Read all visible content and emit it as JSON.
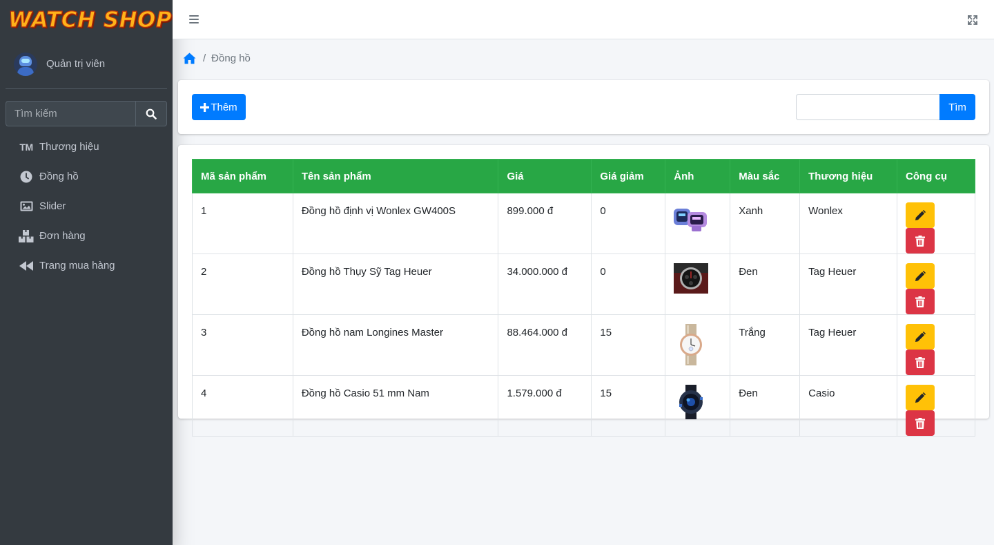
{
  "brand": {
    "logo_text": "WATCH SHOP"
  },
  "user": {
    "name": "Quản trị viên"
  },
  "sidebar": {
    "search_placeholder": "Tìm kiếm",
    "items": [
      {
        "label": "Thương hiệu",
        "icon": "trademark-icon",
        "icon_text": "TM"
      },
      {
        "label": "Đồng hồ",
        "icon": "clock-icon"
      },
      {
        "label": "Slider",
        "icon": "image-icon"
      },
      {
        "label": "Đơn hàng",
        "icon": "boxes-icon"
      },
      {
        "label": "Trang mua hàng",
        "icon": "backward-icon"
      }
    ]
  },
  "breadcrumb": {
    "current": "Đồng hồ"
  },
  "toolbar": {
    "add_label": "Thêm",
    "search_value": "",
    "search_button": "Tìm"
  },
  "table": {
    "headers": [
      "Mã sản phẩm",
      "Tên sản phẩm",
      "Giá",
      "Giá giảm",
      "Ảnh",
      "Màu sắc",
      "Thương hiệu",
      "Công cụ"
    ],
    "rows": [
      {
        "id": "1",
        "name": "Đồng hồ định vị Wonlex GW400S",
        "price": "899.000 đ",
        "discount": "0",
        "color": "Xanh",
        "brand": "Wonlex"
      },
      {
        "id": "2",
        "name": "Đồng hồ Thụy Sỹ Tag Heuer",
        "price": "34.000.000 đ",
        "discount": "0",
        "color": "Đen",
        "brand": "Tag Heuer"
      },
      {
        "id": "3",
        "name": "Đồng hồ nam Longines Master",
        "price": "88.464.000 đ",
        "discount": "15",
        "color": "Trắng",
        "brand": "Tag Heuer"
      },
      {
        "id": "4",
        "name": "Đồng hồ Casio 51 mm Nam",
        "price": "1.579.000 đ",
        "discount": "15",
        "color": "Đen",
        "brand": "Casio"
      }
    ]
  },
  "colors": {
    "sidebar_bg": "#343a40",
    "primary": "#007bff",
    "success": "#28a745",
    "warning": "#ffc107",
    "danger": "#dc3545"
  }
}
